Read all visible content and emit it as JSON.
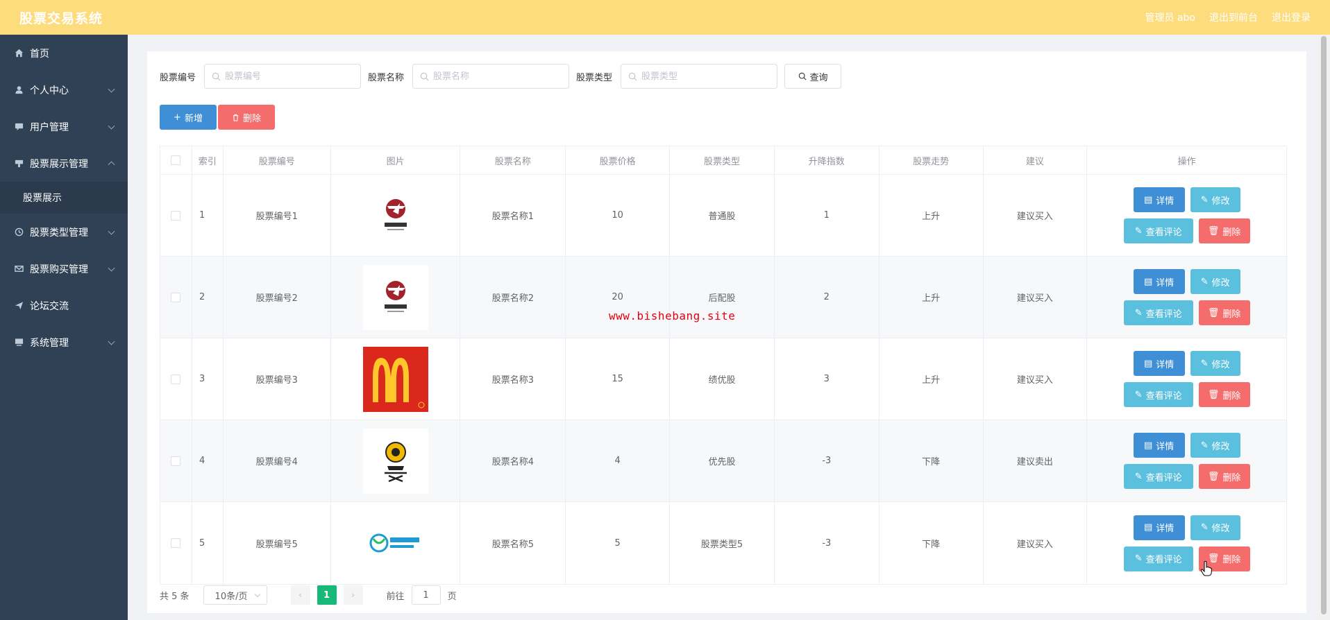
{
  "header": {
    "brand": "股票交易系统",
    "user_label": "管理员 abo",
    "back_to_front": "退出到前台",
    "logout": "退出登录",
    "bg_color": "#fddc7e"
  },
  "sidebar": {
    "items": [
      {
        "label": "首页",
        "icon": "home-icon"
      },
      {
        "label": "个人中心",
        "icon": "user-icon"
      },
      {
        "label": "用户管理",
        "icon": "chat-icon"
      },
      {
        "label": "股票展示管理",
        "icon": "tag-icon",
        "expanded": true
      },
      {
        "label": "股票展示",
        "sub": true
      },
      {
        "label": "股票类型管理",
        "icon": "clock-icon"
      },
      {
        "label": "股票购买管理",
        "icon": "mail-icon"
      },
      {
        "label": "论坛交流",
        "icon": "send-icon"
      },
      {
        "label": "系统管理",
        "icon": "monitor-icon"
      }
    ]
  },
  "search": {
    "code_label": "股票编号",
    "code_placeholder": "股票编号",
    "name_label": "股票名称",
    "name_placeholder": "股票名称",
    "type_label": "股票类型",
    "type_placeholder": "股票类型",
    "query_button": "查询"
  },
  "actions": {
    "add_button": "新增",
    "delete_button": "删除"
  },
  "table": {
    "columns": [
      "索引",
      "股票编号",
      "图片",
      "股票名称",
      "股票价格",
      "股票类型",
      "升降指数",
      "股票走势",
      "建议",
      "操作"
    ],
    "rows": [
      {
        "index": "1",
        "code": "股票编号1",
        "image": "tengfei-logo",
        "name": "股票名称1",
        "price": "10",
        "type": "普通股",
        "change": "1",
        "trend": "上升",
        "advice": "建议买入"
      },
      {
        "index": "2",
        "code": "股票编号2",
        "image": "tengfei-logo",
        "name": "股票名称2",
        "price": "20",
        "type": "后配股",
        "change": "2",
        "trend": "上升",
        "advice": "建议买入"
      },
      {
        "index": "3",
        "code": "股票编号3",
        "image": "mcdonalds-logo",
        "name": "股票名称3",
        "price": "15",
        "type": "绩优股",
        "change": "3",
        "trend": "上升",
        "advice": "建议买入"
      },
      {
        "index": "4",
        "code": "股票编号4",
        "image": "photo-studio-logo",
        "name": "股票名称4",
        "price": "4",
        "type": "优先股",
        "change": "-3",
        "trend": "下降",
        "advice": "建议卖出"
      },
      {
        "index": "5",
        "code": "股票编号5",
        "image": "china-mobile-logo",
        "name": "股票名称5",
        "price": "5",
        "type": "股票类型5",
        "change": "-3",
        "trend": "下降",
        "advice": "建议买入"
      }
    ],
    "op_detail": "详情",
    "op_edit": "修改",
    "op_comment": "查看评论",
    "op_delete": "删除"
  },
  "pagination": {
    "total": "共 5 条",
    "page_size": "10条/页",
    "current_page": "1",
    "goto_label": "前往",
    "goto_value": "1",
    "page_suffix": "页"
  },
  "watermark": "www.bishebang.site",
  "colors": {
    "primary": "#3f8fd6",
    "info": "#5bc0de",
    "danger": "#f56c6c",
    "active_page": "#17b978",
    "sidebar": "#304156"
  }
}
